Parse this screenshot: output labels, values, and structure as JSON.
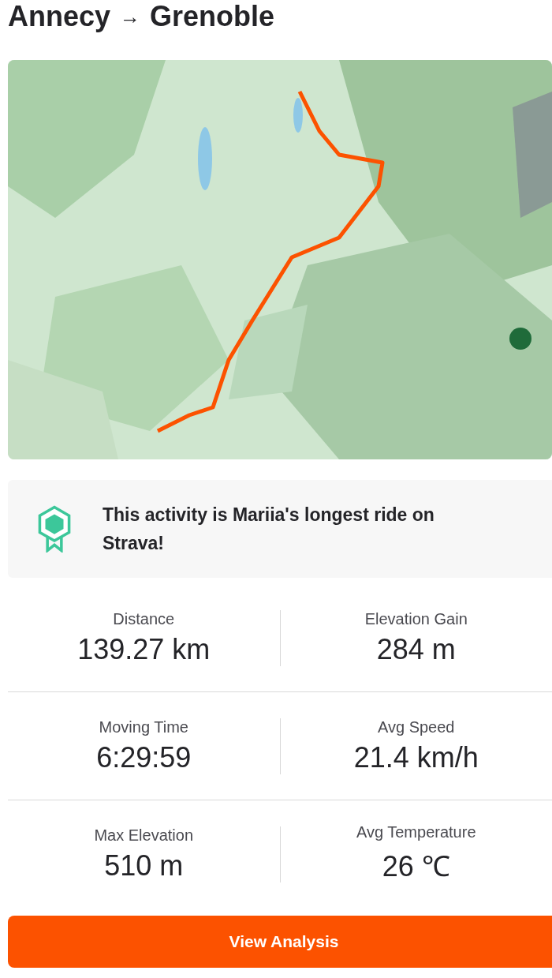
{
  "title": {
    "from": "Annecy",
    "arrow": "→",
    "to": "Grenoble"
  },
  "achievement": {
    "text": "This activity is Mariia's longest ride on Strava!"
  },
  "stats": [
    {
      "label": "Distance",
      "value": "139.27 km"
    },
    {
      "label": "Elevation Gain",
      "value": "284 m"
    },
    {
      "label": "Moving Time",
      "value": "6:29:59"
    },
    {
      "label": "Avg Speed",
      "value": "21.4 km/h"
    },
    {
      "label": "Max Elevation",
      "value": "510 m"
    },
    {
      "label": "Avg Temperature",
      "value": "26 ℃"
    }
  ],
  "button": {
    "label": "View Analysis"
  }
}
